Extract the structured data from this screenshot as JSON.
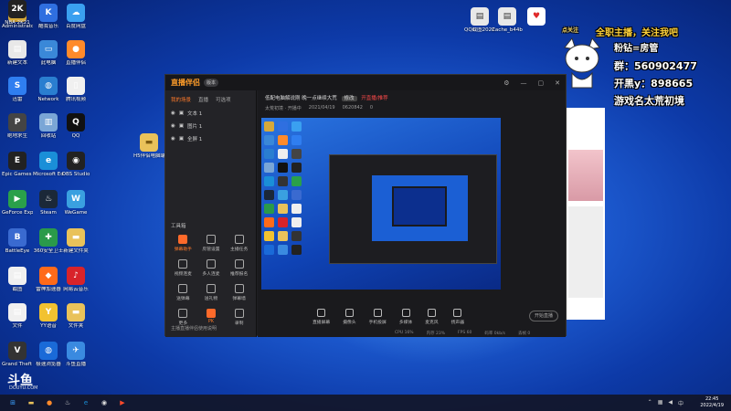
{
  "desktop_icons": [
    {
      "label": "Administrator",
      "color": "#d6a93a",
      "glyph": "◼"
    },
    {
      "label": "酷我音乐",
      "color": "#2f6fe0",
      "glyph": "K"
    },
    {
      "label": "百度网盘",
      "color": "#3aa0f0",
      "glyph": "☁"
    },
    {
      "label": "新建文本",
      "color": "#e8e8e8",
      "glyph": "▤"
    },
    {
      "label": "此电脑",
      "color": "#3a88d8",
      "glyph": "▭"
    },
    {
      "label": "直播伴侣",
      "color": "#ff8a2a",
      "glyph": "●"
    },
    {
      "label": "迅雷",
      "color": "#2f7ef0",
      "glyph": "S"
    },
    {
      "label": "Network",
      "color": "#2a7ed0",
      "glyph": "◍"
    },
    {
      "label": "腾讯视频",
      "color": "#f0f0f0",
      "glyph": "▯"
    },
    {
      "label": "绝地求生",
      "color": "#444",
      "glyph": "P"
    },
    {
      "label": "回收站",
      "color": "#7aa6d6",
      "glyph": "▥"
    },
    {
      "label": "QQ",
      "color": "#111",
      "glyph": "Q"
    },
    {
      "label": "Epic Games Launcher",
      "color": "#222",
      "glyph": "E"
    },
    {
      "label": "Microsoft Edge",
      "color": "#1a8fd8",
      "glyph": "e"
    },
    {
      "label": "OBS Studio",
      "color": "#222",
      "glyph": "◉"
    },
    {
      "label": "GeForce Experience",
      "color": "#2aa04a",
      "glyph": "▶"
    },
    {
      "label": "Steam",
      "color": "#1b2838",
      "glyph": "♨"
    },
    {
      "label": "WeGame",
      "color": "#3aa0e0",
      "glyph": "W"
    },
    {
      "label": "BattleEye",
      "color": "#3a6ad0",
      "glyph": "B"
    },
    {
      "label": "360安全卫士",
      "color": "#2a9a4a",
      "glyph": "✚"
    },
    {
      "label": "新建文件夹",
      "color": "#e9c25a",
      "glyph": "▬"
    },
    {
      "label": "截图",
      "color": "#f0f0f0",
      "glyph": "▤"
    },
    {
      "label": "雷神加速器",
      "color": "#ff6a1a",
      "glyph": "◆"
    },
    {
      "label": "网易云音乐",
      "color": "#d8232a",
      "glyph": "♪"
    },
    {
      "label": "文件",
      "color": "#f0f0f0",
      "glyph": "▤"
    },
    {
      "label": "YY语音",
      "color": "#f2c230",
      "glyph": "Y"
    },
    {
      "label": "文件夹",
      "color": "#e9c25a",
      "glyph": "▬"
    },
    {
      "label": "Grand Theft Auto V",
      "color": "#333",
      "glyph": "V"
    },
    {
      "label": "极速浏览器",
      "color": "#1a6ad8",
      "glyph": "◍"
    },
    {
      "label": "斗鱼直播",
      "color": "#3a8ae0",
      "glyph": "✈"
    },
    {
      "label": "NBA 2K21",
      "color": "#222",
      "glyph": "2K"
    }
  ],
  "top_icons": [
    {
      "label": "QQ截图20220101",
      "color": "#e8e8e8"
    },
    {
      "label": "Cache_b44b",
      "color": "#e8e8e8"
    }
  ],
  "desktop_file": {
    "label": "H5伴侣电脑端",
    "color": "#e9c25a"
  },
  "overlay": {
    "line1": "全职主播，关注我吧",
    "line2": "粉钻=房管",
    "line3": "群：560902477",
    "line4": "开黑y：898665",
    "line5": "游戏名太荒初境",
    "badge": "点关注"
  },
  "app": {
    "title": "直播伴侣",
    "version": "版本",
    "tabs": [
      "我的场景",
      "直播",
      "可选项"
    ],
    "sources": [
      "文本 1",
      "图片 1",
      "全屏 1"
    ],
    "tools_title": "工具箱",
    "tools": [
      {
        "label": "弹幕助手",
        "hot": true
      },
      {
        "label": "房管设置",
        "hot": false
      },
      {
        "label": "主播任务",
        "hot": false
      },
      {
        "label": "视频连麦",
        "hot": false
      },
      {
        "label": "多人连麦",
        "hot": false
      },
      {
        "label": "推荐报名",
        "hot": false
      },
      {
        "label": "送弹幕",
        "hot": false
      },
      {
        "label": "送礼物",
        "hot": false
      },
      {
        "label": "弹幕墙",
        "hot": false
      },
      {
        "label": "更多",
        "hot": false
      },
      {
        "label": "PK",
        "hot": true
      },
      {
        "label": "录制",
        "hot": false
      }
    ],
    "foot": "主播直播伴侣使用说明",
    "room_title": "低配电脑解说刚 晚一点继续大荒",
    "room_tag": "修改",
    "room_red": "开直播/推荐",
    "row2": [
      "太荒初境 · 开播中",
      "2021/04/19",
      "0620842",
      "0"
    ],
    "controls": [
      "直播屏幕",
      "摄像头",
      "手机投屏",
      "多媒体",
      "麦克风",
      "扬声器"
    ],
    "start": "开始直播",
    "status": [
      "CPU 16%",
      "内存 23%",
      "FPS 60",
      "码率 0kb/s",
      "丢帧 0"
    ]
  },
  "watermark": {
    "brand": "斗鱼",
    "sub": "DOUYU.COM"
  },
  "taskbar": {
    "icons": [
      {
        "name": "windows-icon",
        "glyph": "⊞",
        "color": "#3aa0ff"
      },
      {
        "name": "explorer-icon",
        "glyph": "▬",
        "color": "#e9c25a"
      },
      {
        "name": "app-icon",
        "glyph": "●",
        "color": "#ff8a2a"
      },
      {
        "name": "steam-icon",
        "glyph": "♨",
        "color": "#ccc"
      },
      {
        "name": "edge-icon",
        "glyph": "e",
        "color": "#1a8fd8"
      },
      {
        "name": "obs-icon",
        "glyph": "◉",
        "color": "#ddd"
      },
      {
        "name": "live-icon",
        "glyph": "▶",
        "color": "#ff4a2a"
      }
    ],
    "time": "22:45",
    "date": "2022/4/19"
  }
}
